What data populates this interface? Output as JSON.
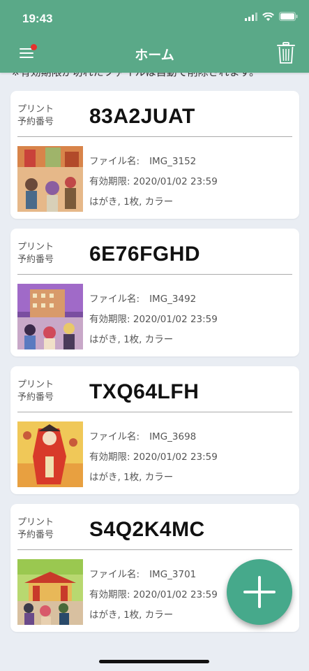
{
  "status_bar": {
    "time": "19:43"
  },
  "header": {
    "title": "ホーム"
  },
  "notice": "※有効期限が切れたファイルは自動で削除されます。",
  "card_label_line1": "プリント",
  "card_label_line2": "予約番号",
  "field_labels": {
    "file_name": "ファイル名:",
    "expiry": "有効期限:"
  },
  "cards": [
    {
      "code": "83A2JUAT",
      "file_name": "IMG_3152",
      "expiry": "2020/01/02 23:59",
      "details": "はがき, 1枚, カラー"
    },
    {
      "code": "6E76FGHD",
      "file_name": "IMG_3492",
      "expiry": "2020/01/02 23:59",
      "details": "はがき, 1枚, カラー"
    },
    {
      "code": "TXQ64LFH",
      "file_name": "IMG_3698",
      "expiry": "2020/01/02 23:59",
      "details": "はがき, 1枚, カラー"
    },
    {
      "code": "S4Q2K4MC",
      "file_name": "IMG_3701",
      "expiry": "2020/01/02 23:59",
      "details": "はがき, 1枚, カラー"
    }
  ],
  "colors": {
    "header": "#5aa988",
    "fab": "#46a98b",
    "badge": "#e5322d"
  },
  "icons": [
    "menu-icon",
    "trash-icon",
    "plus-icon",
    "signal-icon",
    "wifi-icon",
    "battery-icon"
  ]
}
